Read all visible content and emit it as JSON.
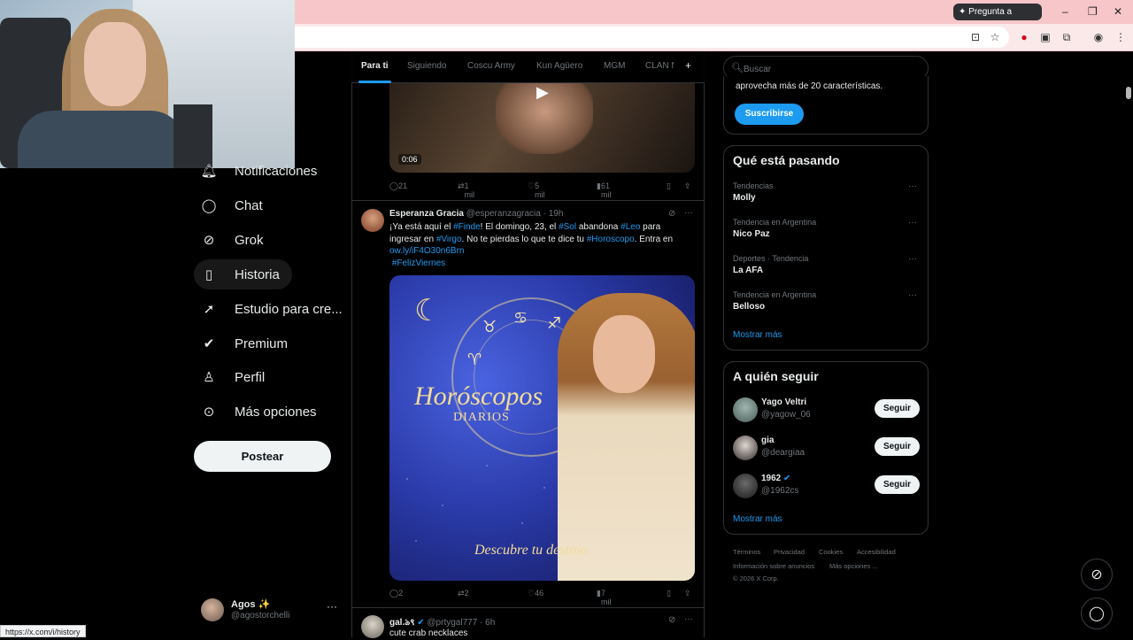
{
  "browser": {
    "gemini_label": "Pregunta a Gemini",
    "status_url": "https://x.com/i/history"
  },
  "sidebar": {
    "items": [
      {
        "label": "Notificaciones",
        "icon": "bell-icon"
      },
      {
        "label": "Chat",
        "icon": "chat-icon"
      },
      {
        "label": "Grok",
        "icon": "grok-icon"
      },
      {
        "label": "Historia",
        "icon": "bookmark-icon"
      },
      {
        "label": "Estudio para cre...",
        "icon": "rocket-icon"
      },
      {
        "label": "Premium",
        "icon": "verified-icon"
      },
      {
        "label": "Perfil",
        "icon": "person-icon"
      },
      {
        "label": "Más opciones",
        "icon": "more-circle-icon"
      }
    ],
    "post_label": "Postear",
    "account": {
      "name": "Agos ✨",
      "handle": "@agostorchelli",
      "more": "···"
    }
  },
  "feed": {
    "tabs": [
      "Para ti",
      "Siguiendo",
      "Coscu Army",
      "Kun Agüero",
      "MGM",
      "CLAN M"
    ],
    "add_tab": "+",
    "video": {
      "duration": "0:06"
    },
    "tweet1_actions": {
      "replies": "21",
      "reposts": "1 mil",
      "likes": "5 mil",
      "views": "61 mil"
    },
    "tweet2": {
      "name": "Esperanza Gracia",
      "handle": "@esperanzagracia",
      "time": "· 19h",
      "text_parts": {
        "p1": "¡Ya está aquí el ",
        "h1": "#Finde",
        "p2": "! El domingo, 23, el ",
        "h2": "#Sol",
        "p3": " abandona ",
        "h3": "#Leo",
        "p4": " para ingresar en ",
        "h4": "#Virgo",
        "p5": ". No te pierdas lo que te dice tu ",
        "h5": "#Horoscopo",
        "p6": ".   Entra en ",
        "link": "ow.ly/iF4O30n6Brn",
        "h6": "#FelizViernes"
      },
      "image": {
        "title": "Horóscopos",
        "subtitle": "DIARIOS",
        "tagline": "Descubre tu destino"
      },
      "actions": {
        "replies": "2",
        "reposts": "2",
        "likes": "46",
        "views": "7 mil"
      }
    },
    "tweet3": {
      "name": "gal.ঌ९",
      "handle": "@prtygal777",
      "time": "· 6h",
      "text": "cute crab necklaces"
    }
  },
  "right": {
    "search_placeholder": "Buscar",
    "premium_text": "aprovecha más de 20 características.",
    "subscribe_label": "Suscribirse",
    "trends_title": "Qué está pasando",
    "trends": [
      {
        "category": "Tendencias",
        "name": "Molly"
      },
      {
        "category": "Tendencia en Argentina",
        "name": "Nico Paz"
      },
      {
        "category": "Deportes · Tendencia",
        "name": "La AFA"
      },
      {
        "category": "Tendencia en Argentina",
        "name": "Belloso"
      }
    ],
    "show_more": "Mostrar más",
    "follow_title": "A quién seguir",
    "follow": [
      {
        "name": "Yago Veltri",
        "handle": "@yagow_06",
        "button": "Seguir"
      },
      {
        "name": "gia",
        "handle": "@deargiaa",
        "button": "Seguir"
      },
      {
        "name": "1962",
        "handle": "@1962cs",
        "button": "Seguir"
      }
    ],
    "footer": [
      "Términos",
      "Privacidad",
      "Cookies",
      "Accesibilidad",
      "Información sobre anuncios",
      "Más opciones ...",
      "© 2026 X Corp."
    ]
  },
  "colors": {
    "accent": "#1d9bf0",
    "background": "#000000",
    "titlebar": "#f6c6c9"
  }
}
